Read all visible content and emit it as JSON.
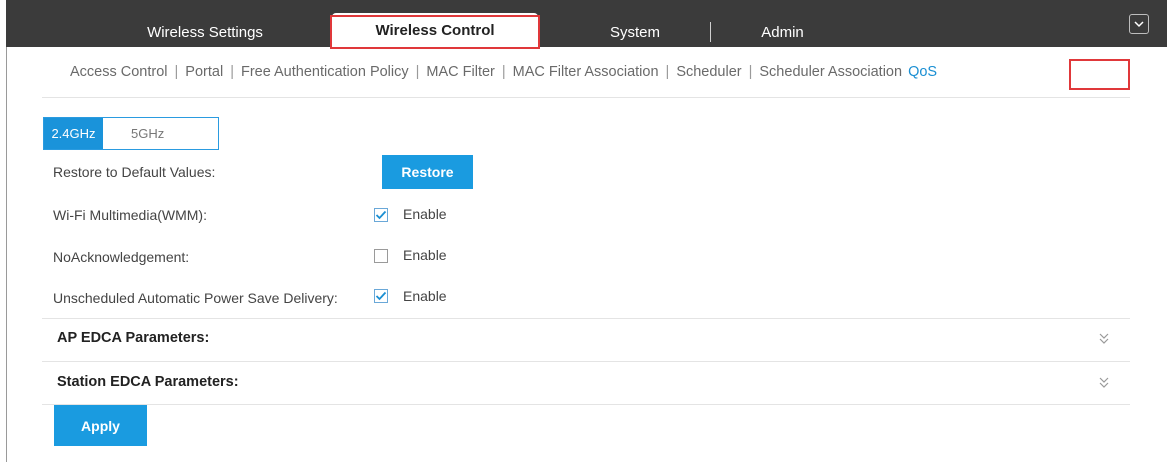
{
  "top_tabs": [
    {
      "label": "Wireless Settings"
    },
    {
      "label": "Wireless Control"
    },
    {
      "label": "System"
    },
    {
      "label": "Admin"
    }
  ],
  "sub_nav": [
    {
      "label": "Access Control"
    },
    {
      "label": "Portal"
    },
    {
      "label": "Free Authentication Policy"
    },
    {
      "label": "MAC Filter"
    },
    {
      "label": "MAC Filter Association"
    },
    {
      "label": "Scheduler"
    },
    {
      "label": "Scheduler Association"
    },
    {
      "label": "QoS"
    }
  ],
  "sub_nav_separator": "|",
  "bands": {
    "active": "2.4GHz",
    "other": "5GHz"
  },
  "restore": {
    "label": "Restore to Default Values:",
    "button": "Restore"
  },
  "wmm": {
    "label": "Wi-Fi Multimedia(WMM):",
    "checked": true,
    "option": "Enable"
  },
  "noack": {
    "label": "NoAcknowledgement:",
    "checked": false,
    "option": "Enable"
  },
  "uapsd": {
    "label": "Unscheduled Automatic Power Save Delivery:",
    "checked": true,
    "option": "Enable"
  },
  "sections": [
    {
      "title": "AP EDCA Parameters:"
    },
    {
      "title": "Station EDCA Parameters:"
    }
  ],
  "apply_button": "Apply",
  "colors": {
    "accent": "#1a9be0",
    "highlight": "#e0383a",
    "topbar": "#3b3b3b"
  },
  "icons": {
    "dropdown": "chevron-down-icon",
    "expand": "double-chevron-down-icon",
    "check": "check-icon"
  }
}
